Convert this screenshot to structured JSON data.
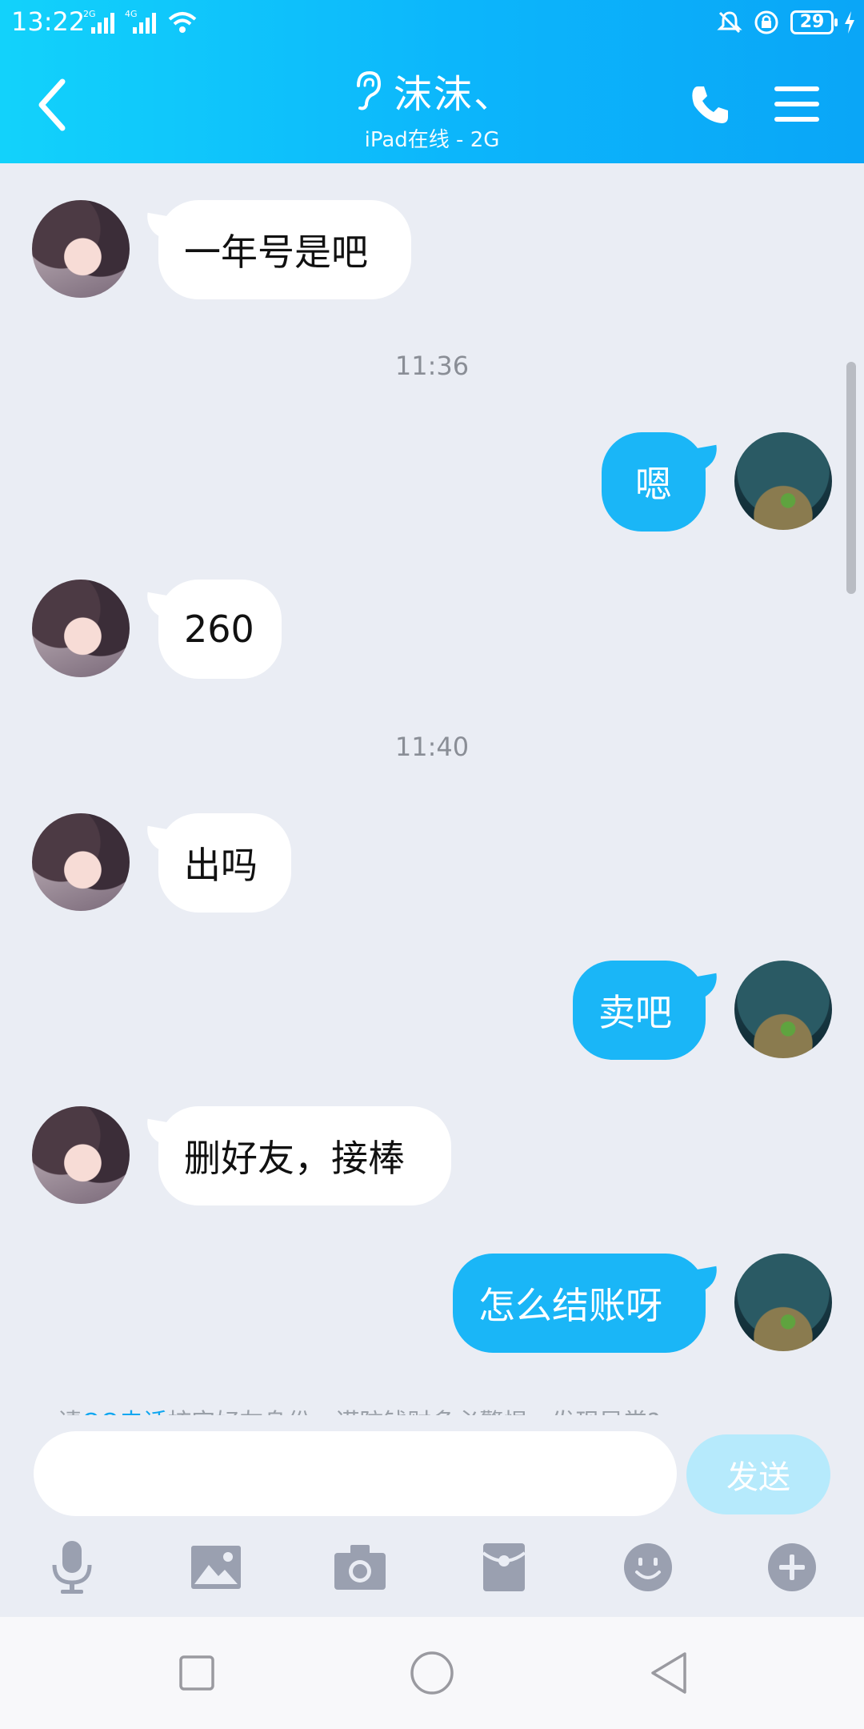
{
  "status_bar": {
    "time": "13:22",
    "network_1": "2G",
    "network_2": "4G",
    "battery": "29"
  },
  "header": {
    "title": "沫沫、",
    "subtitle": "iPad在线 - 2G",
    "icons": [
      "back-arrow-icon",
      "ear-icon",
      "phone-icon",
      "menu-icon"
    ]
  },
  "messages": [
    {
      "from": "other",
      "text": "一年号是吧"
    },
    {
      "timestamp": "11:36"
    },
    {
      "from": "me",
      "text": "嗯"
    },
    {
      "from": "other",
      "text": "260"
    },
    {
      "timestamp": "11:40"
    },
    {
      "from": "other",
      "text": "出吗"
    },
    {
      "from": "me",
      "text": "卖吧"
    },
    {
      "from": "other",
      "text": "删好友，接棒"
    },
    {
      "from": "me",
      "text": "怎么结账呀"
    }
  ],
  "notice": {
    "prefix": "请",
    "link": "QQ电话",
    "suffix": "核实好友身份，谨防钱财多必警惕，发现异常?"
  },
  "input": {
    "placeholder": "",
    "send_label": "发送"
  },
  "toolbar": [
    "microphone-icon",
    "image-icon",
    "camera-icon",
    "red-packet-icon",
    "emoji-icon",
    "plus-icon"
  ],
  "nav": [
    "recent-apps-icon",
    "home-icon",
    "back-icon"
  ],
  "colors": {
    "header_start": "#12d2fb",
    "header_end": "#0aa6f7",
    "outgoing_bubble": "#1ab6f7",
    "incoming_bubble": "#ffffff",
    "send_button": "#b6eafc",
    "chat_background": "#eaedf4"
  }
}
